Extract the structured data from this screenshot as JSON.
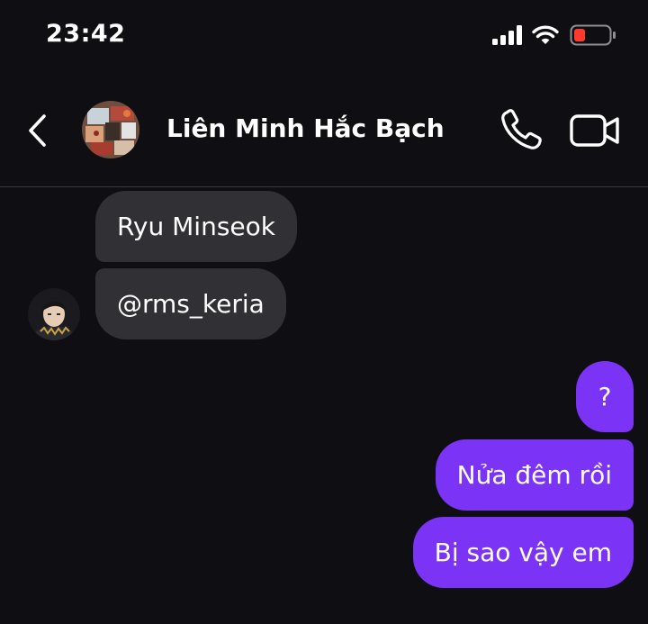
{
  "status_bar": {
    "time": "23:42",
    "signal_icon": "cellular-signal-icon",
    "wifi_icon": "wifi-icon",
    "battery_icon": "battery-low-icon",
    "battery_level": 0.15,
    "battery_color": "#ff3b30"
  },
  "header": {
    "back_icon": "chevron-left-icon",
    "group_name": "Liên Minh Hắc Bạch",
    "call_icon": "phone-icon",
    "video_icon": "video-camera-icon"
  },
  "messages": [
    {
      "direction": "incoming",
      "text": "Ryu Minseok"
    },
    {
      "direction": "incoming",
      "text": "@rms_keria"
    },
    {
      "direction": "outgoing",
      "text": "?"
    },
    {
      "direction": "outgoing",
      "text": "Nửa đêm rồi"
    },
    {
      "direction": "outgoing",
      "text": "Bị sao vậy em"
    }
  ],
  "colors": {
    "background": "#0e0e13",
    "incoming_bubble": "#303035",
    "outgoing_bubble": "#7b33f6"
  }
}
